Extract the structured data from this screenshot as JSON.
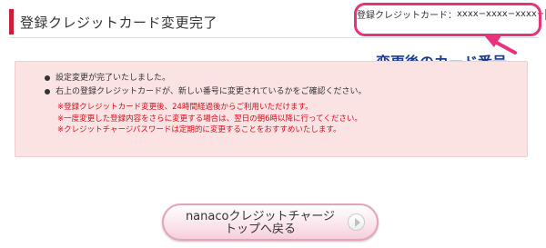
{
  "header": {
    "title": "登録クレジットカード変更完了",
    "card_label": "登録クレジットカード：",
    "card_number": "xxxx−xxxx−xxxx−"
  },
  "annotation": {
    "text": "変更後のカード番号"
  },
  "message": {
    "bullets": [
      "設定変更が完了いたしました。",
      "右上の登録クレジットカードが、新しい番号に変更されているかをご確認ください。"
    ],
    "notes": [
      "※登録クレジットカード変更後、24時間経過後からご利用いただけます。",
      "※一度変更した登録内容をさらに変更する場合は、翌日の朝6時以降に行ってください。",
      "※クレジットチャージパスワードは定期的に変更することをおすすめいたします。"
    ]
  },
  "back_button": {
    "label": "nanacoクレジットチャージ\nトップへ戻る"
  },
  "colors": {
    "accent": "#cc1f3c",
    "highlight": "#e8327a",
    "annotation": "#1d3c8c",
    "panel": "#fbe3e4",
    "note_text": "#d0101c"
  },
  "icons": {
    "back_button_icon": "play-triangle-icon"
  }
}
